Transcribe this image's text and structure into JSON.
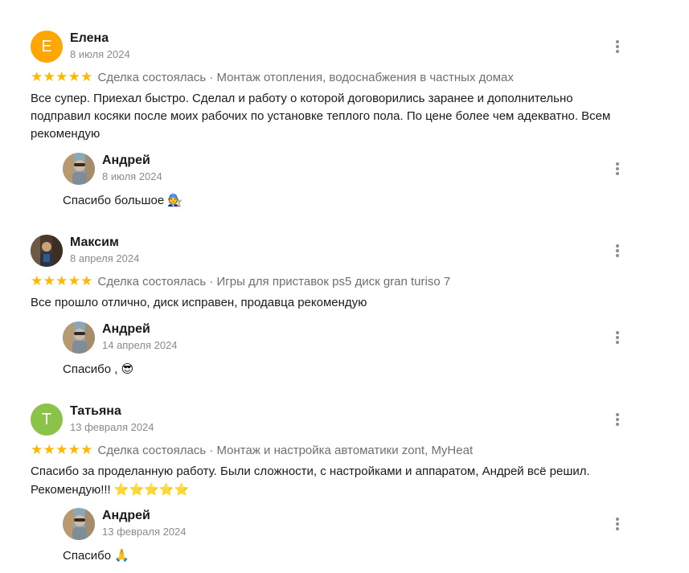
{
  "reviews": [
    {
      "avatar_letter": "Е",
      "avatar_color": "#ffa600",
      "name": "Елена",
      "date": "8 июля 2024",
      "rating": 5,
      "deal": "Сделка состоялась · Монтаж отопления, водоснабжения в частных домах",
      "text": "Все супер. Приехал быстро. Сделал и работу о которой договорились заранее и дополнительно подправил косяки после моих рабочих по установке теплого пола. По цене более чем адекватно. Всем рекомендую",
      "reply": {
        "name": "Андрей",
        "date": "8 июля 2024",
        "text": "Спасибо большое",
        "emoji": "🧑‍🔧"
      }
    },
    {
      "avatar_letter": "",
      "avatar_color": "#5a4a3a",
      "name": "Максим",
      "date": "8 апреля 2024",
      "rating": 5,
      "deal": "Сделка состоялась · Игры для приставок ps5 диск gran turiso 7",
      "text": "Все прошло отлично, диск исправен, продавца рекомендую",
      "reply": {
        "name": "Андрей",
        "date": "14 апреля 2024",
        "text": "Спасибо ,",
        "emoji": "😎"
      }
    },
    {
      "avatar_letter": "Т",
      "avatar_color": "#8bc34a",
      "name": "Татьяна",
      "date": "13 февраля 2024",
      "rating": 5,
      "deal": "Сделка состоялась · Монтаж и настройка автоматики zont, MyHeat",
      "text": "Спасибо за проделанную работу. Были сложности, с настройками и аппаратом, Андрей всё решил. Рекомендую!!!",
      "text_emoji": "⭐⭐⭐⭐⭐",
      "reply": {
        "name": "Андрей",
        "date": "13 февраля 2024",
        "text": "Спасибо",
        "emoji": "🙏"
      }
    }
  ],
  "icons": {
    "rating_star": "star-icon",
    "more": "more-vertical-icon"
  },
  "colors": {
    "star": "#ffb800",
    "date": "#8a8a8a",
    "meta": "#6f6f6f"
  }
}
